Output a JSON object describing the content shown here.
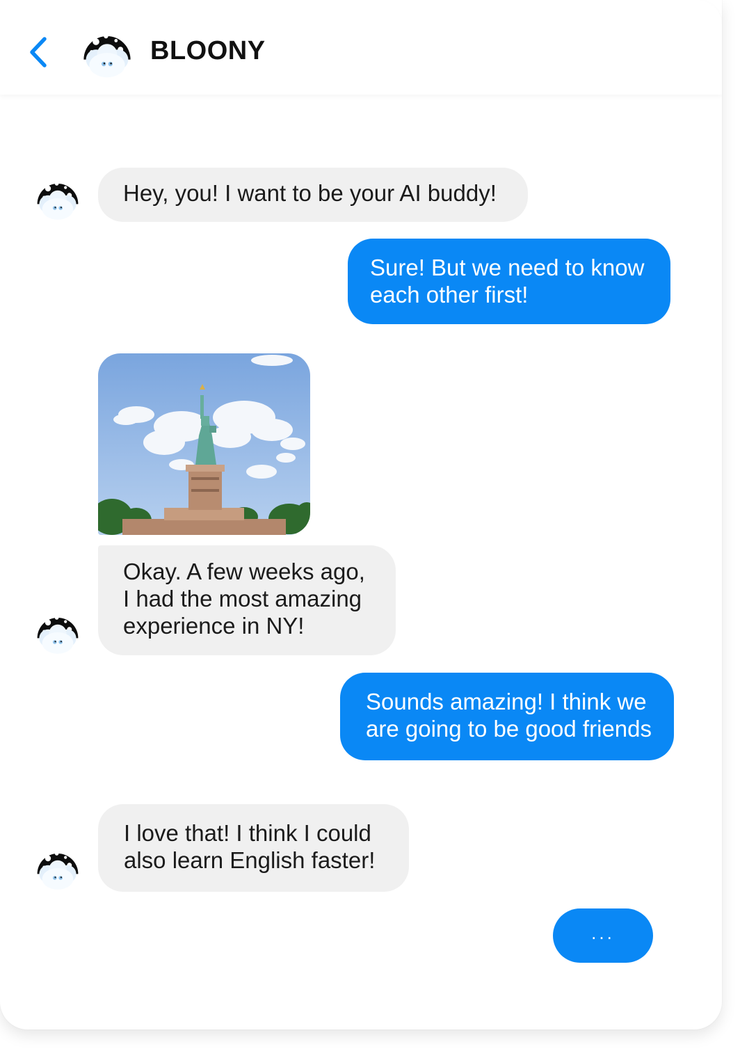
{
  "header": {
    "title": "BLOONY",
    "back_icon": "chevron-left-icon",
    "accent_color": "#0a88f5"
  },
  "messages": [
    {
      "from": "bot",
      "text": "Hey, you! I want to be your AI buddy!"
    },
    {
      "from": "user",
      "lines": [
        "Sure! But we need to know",
        "each other first!"
      ]
    },
    {
      "from": "bot",
      "type": "image",
      "subject": "statue-of-liberty-photo"
    },
    {
      "from": "bot",
      "lines": [
        "Okay. A few weeks ago,",
        "I had the most amazing",
        "experience in NY!"
      ]
    },
    {
      "from": "user",
      "lines": [
        "Sounds amazing! I think we",
        "are going to be good friends"
      ]
    },
    {
      "from": "bot",
      "lines": [
        "I love that! I think I could",
        "also learn English faster!"
      ]
    }
  ],
  "typing": {
    "label": "..."
  }
}
